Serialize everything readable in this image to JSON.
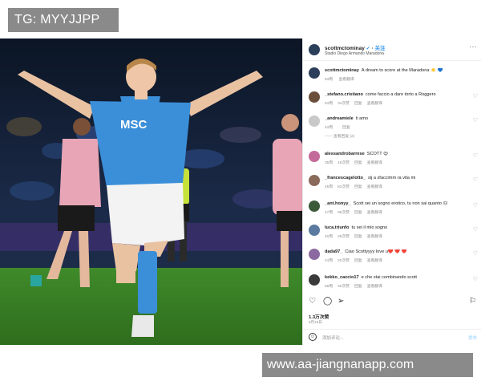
{
  "watermark": {
    "top": "TG: MYYJJPP",
    "bottom": "www.aa-jiangnanapp.com"
  },
  "photo": {
    "shirt_sponsor": "MSC"
  },
  "post": {
    "username": "scottmctominay",
    "follow_label": "关注",
    "location": "Stadio Diego Armando Maradona",
    "more_label": "···",
    "caption": {
      "user": "scottmctominay",
      "text": "A dream to score at the Maradona ☀️ 💙",
      "time": "63周",
      "translate": "查看翻译"
    },
    "comments": [
      {
        "user": "_stefano.cristiano",
        "text": "come faccio a dare torto a Roggero",
        "time": "53周",
        "likes": "34次赞",
        "reply": "回复",
        "translate": "查看翻译",
        "replies": ""
      },
      {
        "user": "_andreamiele",
        "text": "ti amo",
        "time": "43周",
        "likes": "",
        "reply": "回复",
        "translate": "",
        "replies": "—— 查看回复 (2)"
      },
      {
        "user": "alessandrobarrese",
        "text": "SCOTT 😍",
        "time": "35周",
        "likes": "18次赞",
        "reply": "回复",
        "translate": "查看翻译",
        "replies": ""
      },
      {
        "user": "_francescagelotto_",
        "text": "sij a sfaccimm ra vita mi",
        "time": "45周",
        "likes": "62次赞",
        "reply": "回复",
        "translate": "查看翻译",
        "replies": ""
      },
      {
        "user": "_ant.honyy_",
        "text": "Scott sei un sogno erotico, tu non sai quanto 🙃",
        "time": "47周",
        "likes": "88次赞",
        "reply": "回复",
        "translate": "查看翻译",
        "replies": ""
      },
      {
        "user": "luca.triunfo",
        "text": "tu sei il mio sogno",
        "time": "40周",
        "likes": "29次赞",
        "reply": "回复",
        "translate": "查看翻译",
        "replies": ""
      },
      {
        "user": "dada97_",
        "text": "Ciao Scottyyyy love u❤️ ❤️ ❤️",
        "time": "24周",
        "likes": "20次赞",
        "reply": "回复",
        "translate": "查看翻译",
        "replies": ""
      },
      {
        "user": "kekko_caccio17",
        "text": "e che stai combinando scott",
        "time": "58周",
        "likes": "40次赞",
        "reply": "回复",
        "translate": "查看翻译",
        "replies": ""
      }
    ],
    "likes_count": "1.3万次赞",
    "date": "6月18日",
    "add_comment_placeholder": "添加评论...",
    "post_button": "发布"
  },
  "colors": {
    "accent": "#3897f0",
    "watermark_bg": "#8a8a8a",
    "shirt": "#3b8fd9"
  },
  "icons": [
    "heart-icon",
    "comment-icon",
    "share-icon",
    "bookmark-icon",
    "emoji-icon"
  ]
}
